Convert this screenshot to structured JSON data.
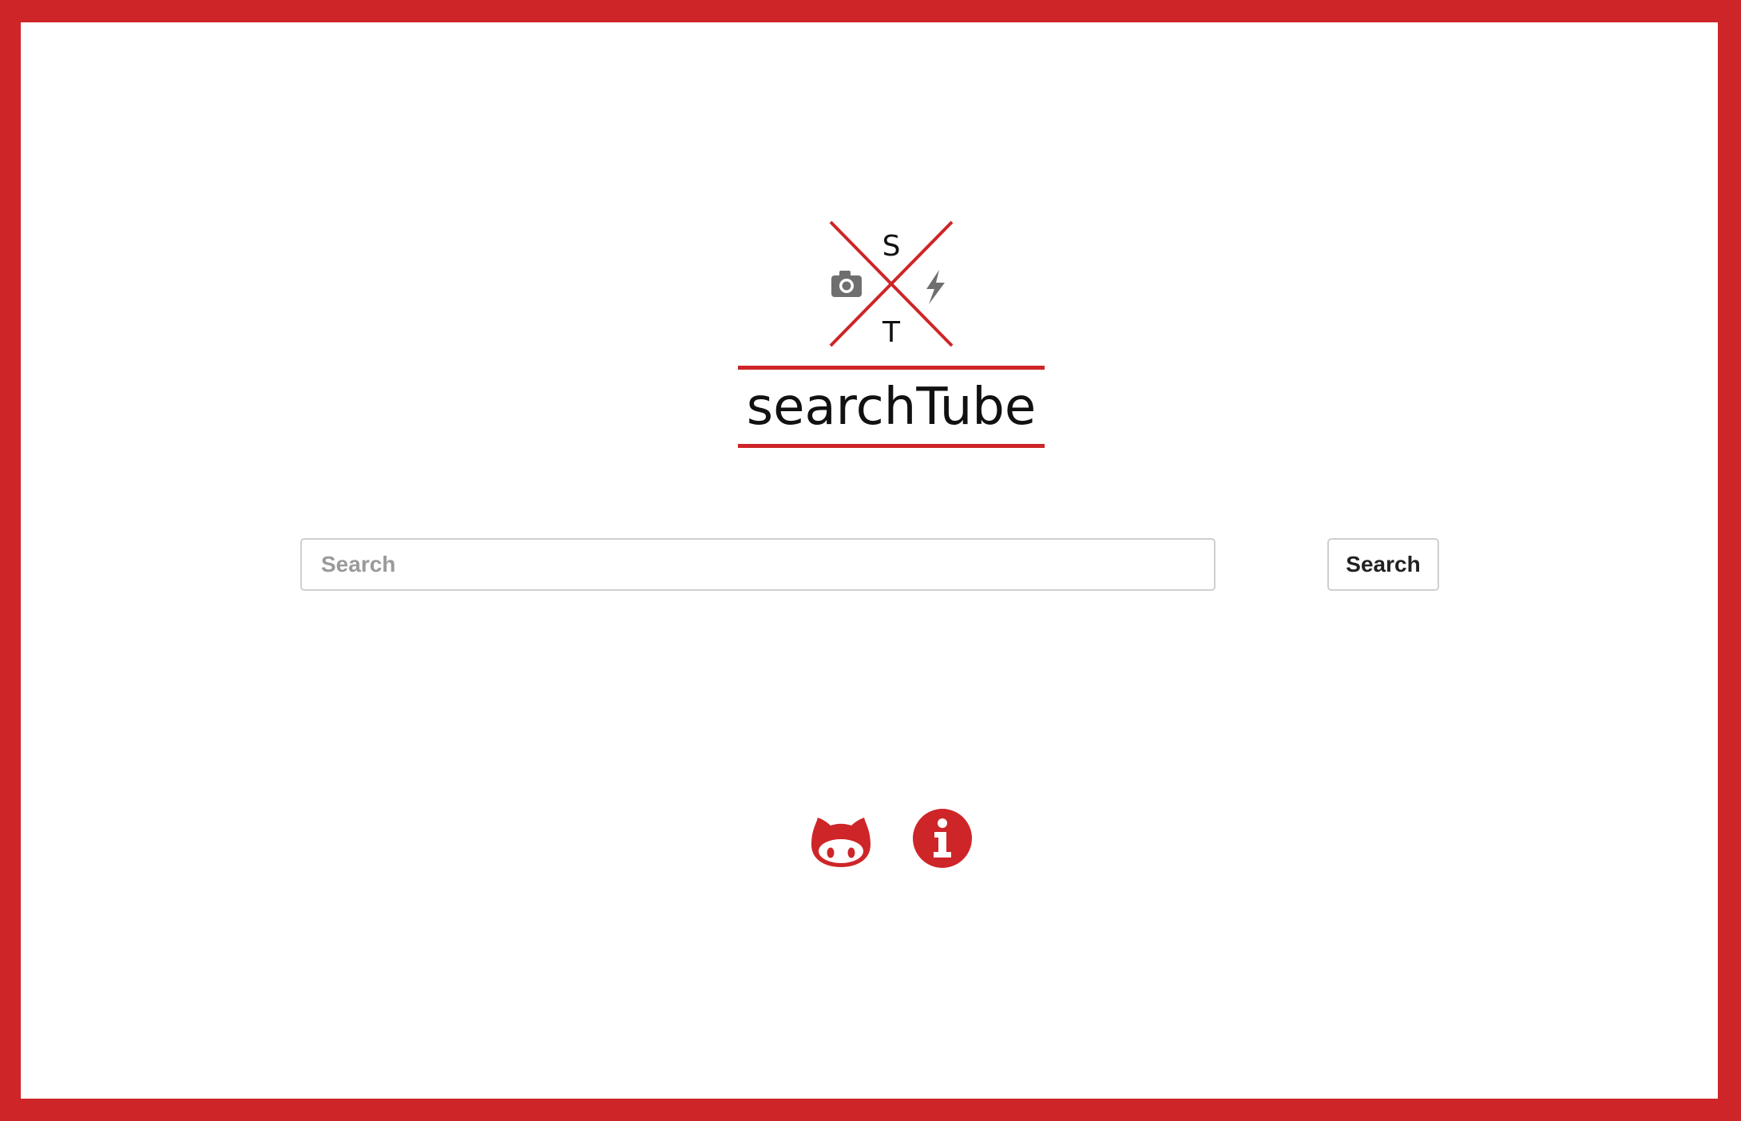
{
  "logo": {
    "monogram_top": "S",
    "monogram_bottom": "T",
    "wordmark": "searchTube",
    "left_icon": "camera-icon",
    "right_icon": "lightning-icon"
  },
  "search": {
    "placeholder": "Search",
    "value": "",
    "button_label": "Search"
  },
  "footer_links": {
    "github": "github-icon",
    "info": "info-icon"
  },
  "colors": {
    "accent": "#ce2528",
    "icon_gray": "#6f6f6f",
    "border": "#cfcfcf",
    "text": "#222222"
  }
}
